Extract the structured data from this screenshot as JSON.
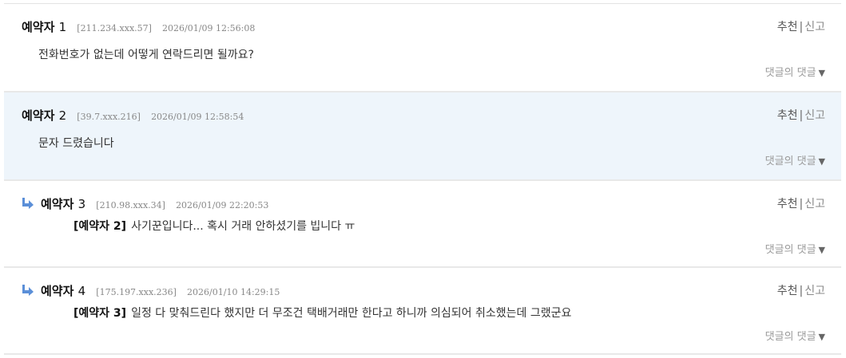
{
  "labels": {
    "recommend": "추천",
    "separator": "|",
    "report": "신고",
    "reply_toggle": "댓글의 댓글",
    "reply_toggle_arrow": "▼"
  },
  "colors": {
    "highlight_bg": "#eef5fb",
    "reply_arrow": "#5b8fd8"
  },
  "comments": [
    {
      "author": "예약자",
      "number": "1",
      "ip": "[211.234.xxx.57]",
      "date": "2026/01/09 12:56:08",
      "mention": "",
      "text": "전화번호가 없는데 어떻게 연락드리면 될까요?"
    },
    {
      "author": "예약자",
      "number": "2",
      "ip": "[39.7.xxx.216]",
      "date": "2026/01/09 12:58:54",
      "mention": "",
      "text": "문자 드렸습니다"
    },
    {
      "author": "예약자",
      "number": "3",
      "ip": "[210.98.xxx.34]",
      "date": "2026/01/09 22:20:53",
      "mention": "[예약자 2]",
      "text": "사기꾼입니다... 혹시 거래 안하셨기를 빕니다 ㅠ"
    },
    {
      "author": "예약자",
      "number": "4",
      "ip": "[175.197.xxx.236]",
      "date": "2026/01/10 14:29:15",
      "mention": "[예약자 3]",
      "text": "일정 다 맞춰드린다 했지만 더 무조건 택배거래만 한다고 하니까 의심되어 취소했는데 그랬군요"
    }
  ]
}
